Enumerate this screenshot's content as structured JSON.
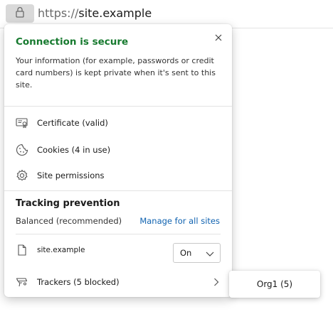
{
  "addressbar": {
    "scheme": "https://",
    "host": "site.example",
    "lock_icon": "lock-icon"
  },
  "flyout": {
    "close_icon": "close-icon",
    "connection_title": "Connection is secure",
    "connection_description": "Your information (for example, passwords or credit card numbers) is kept private when it's sent to this site.",
    "items": [
      {
        "label": "Certificate (valid)",
        "icon": "certificate-icon"
      },
      {
        "label": "Cookies (4 in use)",
        "icon": "cookie-icon"
      },
      {
        "label": "Site permissions",
        "icon": "gear-icon"
      }
    ],
    "tracking": {
      "title": "Tracking prevention",
      "level": "Balanced (recommended)",
      "manage_link": "Manage for all sites",
      "site_label": "site.example",
      "site_icon": "document-icon",
      "toggle_value": "On",
      "trackers_label": "Trackers (5 blocked)",
      "trackers_icon": "tracker-icon"
    }
  },
  "tooltip": {
    "text": "Org1 (5)"
  },
  "colors": {
    "secure_green": "#177a2f",
    "link_blue": "#0f62b0"
  }
}
